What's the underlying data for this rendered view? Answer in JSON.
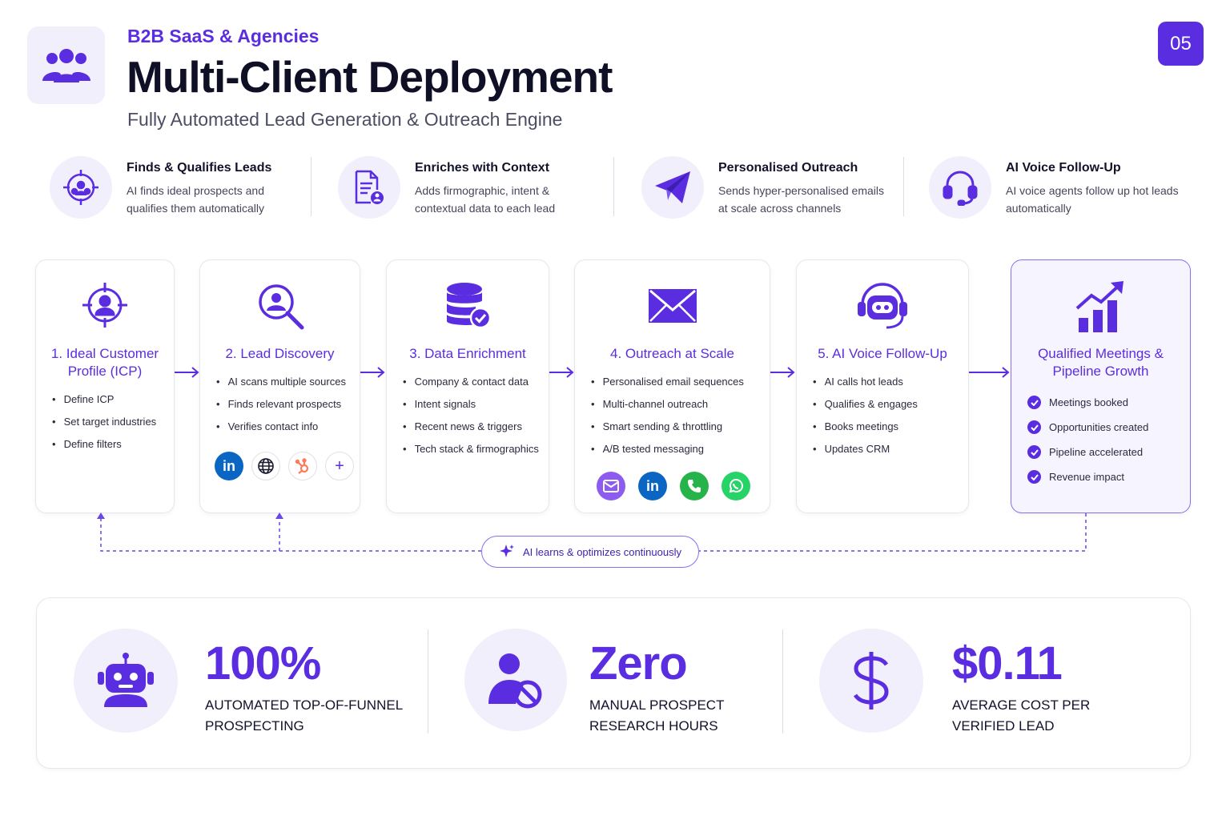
{
  "header": {
    "eyebrow": "B2B SaaS & Agencies",
    "title": "Multi-Client Deployment",
    "subtitle": "Fully Automated Lead Generation & Outreach Engine",
    "page_number": "05",
    "logo_icon": "users-group-icon"
  },
  "features": [
    {
      "icon": "target-team-icon",
      "title": "Finds & Qualifies Leads",
      "desc": "AI finds ideal prospects and qualifies them automatically"
    },
    {
      "icon": "document-user-icon",
      "title": "Enriches with Context",
      "desc": "Adds firmographic, intent & contextual data to each lead"
    },
    {
      "icon": "paper-plane-icon",
      "title": "Personalised Outreach",
      "desc": "Sends hyper-personalised emails at scale across channels"
    },
    {
      "icon": "headset-icon",
      "title": "AI Voice Follow-Up",
      "desc": "AI voice agents follow up hot leads automatically"
    }
  ],
  "steps": [
    {
      "icon": "target-user-icon",
      "title": "1. Ideal Customer Profile (ICP)",
      "items": [
        "Define ICP",
        "Set target industries",
        "Define filters"
      ]
    },
    {
      "icon": "search-user-icon",
      "title": "2. Lead Discovery",
      "items": [
        "AI scans multiple sources",
        "Finds relevant prospects",
        "Verifies contact info"
      ],
      "badges": [
        "linkedin-icon",
        "globe-icon",
        "hubspot-icon",
        "plus-icon"
      ],
      "badge_text": {
        "linkedin": "in",
        "plus": "+"
      }
    },
    {
      "icon": "database-check-icon",
      "title": "3. Data Enrichment",
      "items": [
        "Company & contact data",
        "Intent signals",
        "Recent news & triggers",
        "Tech stack & firmographics"
      ]
    },
    {
      "icon": "envelope-icon",
      "title": "4. Outreach at Scale",
      "items": [
        "Personalised email sequences",
        "Multi-channel outreach",
        "Smart sending & throttling",
        "A/B tested messaging"
      ],
      "badges": [
        "email-icon",
        "linkedin-icon",
        "phone-icon",
        "whatsapp-icon"
      ],
      "badge_text": {
        "linkedin": "in"
      }
    },
    {
      "icon": "robot-headset-icon",
      "title": "5. AI Voice Follow-Up",
      "items": [
        "AI calls hot leads",
        "Qualifies & engages",
        "Books meetings",
        "Updates CRM"
      ]
    },
    {
      "icon": "growth-chart-icon",
      "title": "Qualified Meetings & Pipeline Growth",
      "items": [
        "Meetings booked",
        "Opportunities created",
        "Pipeline accelerated",
        "Revenue impact"
      ]
    }
  ],
  "feedback": {
    "label": "AI learns & optimizes continuously",
    "icon": "sparkle-icon"
  },
  "stats": [
    {
      "icon": "robot-icon",
      "value": "100%",
      "label": "AUTOMATED TOP-OF-FUNNEL PROSPECTING"
    },
    {
      "icon": "user-block-icon",
      "value": "Zero",
      "label": "MANUAL PROSPECT RESEARCH HOURS"
    },
    {
      "icon": "dollar-icon",
      "value": "$0.11",
      "label": "AVERAGE COST PER VERIFIED LEAD"
    }
  ],
  "colors": {
    "accent": "#5b2de0",
    "accent_soft": "#f1effc",
    "linkedin": "#0a66c2",
    "hubspot": "#ff7a59",
    "phone": "#25b34a",
    "whatsapp": "#25d366",
    "email": "#8e5bf0"
  }
}
